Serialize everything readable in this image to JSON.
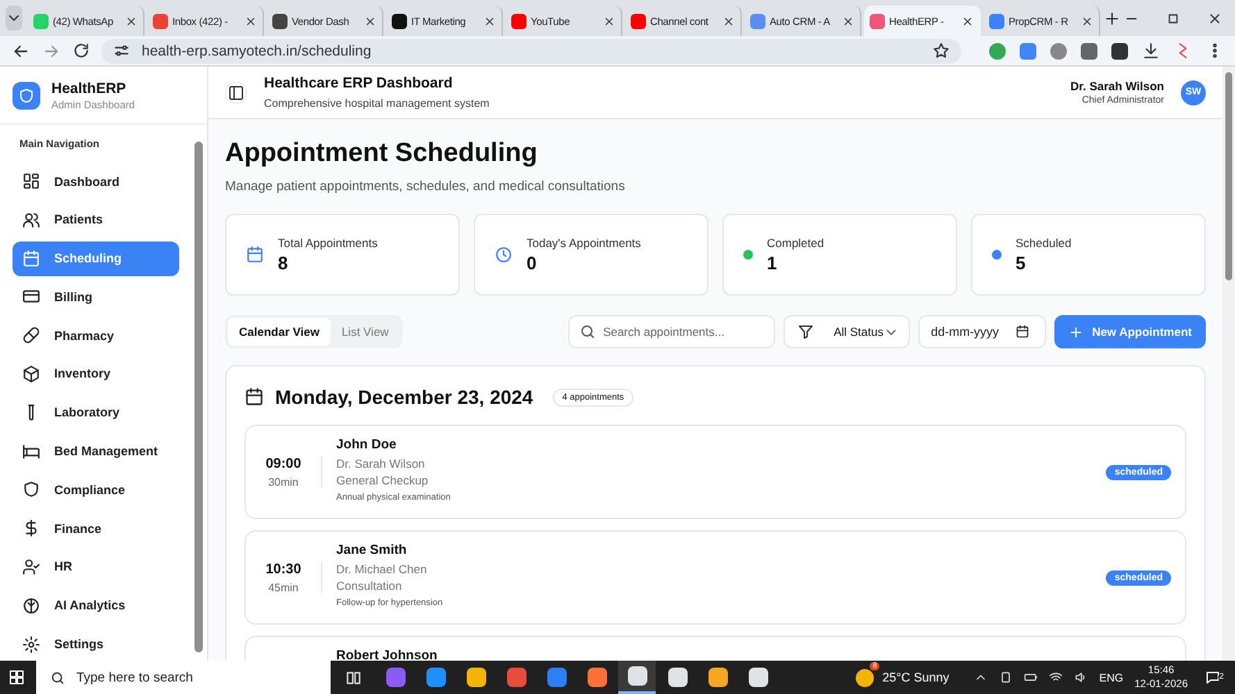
{
  "browser": {
    "tabs": [
      {
        "title": "(42) WhatsAp",
        "selected": false,
        "color": "#25d366"
      },
      {
        "title": "Inbox (422) -",
        "selected": false,
        "color": "#ea4335"
      },
      {
        "title": "Vendor Dash",
        "selected": false,
        "color": "#444444"
      },
      {
        "title": "IT Marketing",
        "selected": false,
        "color": "#111111"
      },
      {
        "title": "YouTube",
        "selected": false,
        "color": "#ff0000"
      },
      {
        "title": "Channel cont",
        "selected": false,
        "color": "#ff0000"
      },
      {
        "title": "Auto CRM - A",
        "selected": false,
        "color": "#5b8def"
      },
      {
        "title": "HealthERP - ",
        "selected": true,
        "color": "#f0567a"
      },
      {
        "title": "PropCRM - R",
        "selected": false,
        "color": "#3b82f6"
      }
    ],
    "url": "health-erp.samyotech.in/scheduling"
  },
  "sidebar": {
    "brand": "HealthERP",
    "tagline": "Admin Dashboard",
    "section": "Main Navigation",
    "items": [
      {
        "label": "Dashboard",
        "selected": false
      },
      {
        "label": "Patients",
        "selected": false
      },
      {
        "label": "Scheduling",
        "selected": true
      },
      {
        "label": "Billing",
        "selected": false
      },
      {
        "label": "Pharmacy",
        "selected": false
      },
      {
        "label": "Inventory",
        "selected": false
      },
      {
        "label": "Laboratory",
        "selected": false
      },
      {
        "label": "Bed Management",
        "selected": false
      },
      {
        "label": "Compliance",
        "selected": false
      },
      {
        "label": "Finance",
        "selected": false
      },
      {
        "label": "HR",
        "selected": false
      },
      {
        "label": "AI Analytics",
        "selected": false
      },
      {
        "label": "Settings",
        "selected": false
      }
    ]
  },
  "header": {
    "title": "Healthcare ERP Dashboard",
    "subtitle": "Comprehensive hospital management system",
    "user": "Dr. Sarah Wilson",
    "role": "Chief Administrator",
    "initials": "SW"
  },
  "page": {
    "title": "Appointment Scheduling",
    "subtitle": "Manage patient appointments, schedules, and medical consultations"
  },
  "stats": [
    {
      "label": "Total Appointments",
      "value": "8",
      "kind": "calendar"
    },
    {
      "label": "Today's Appointments",
      "value": "0",
      "kind": "clock"
    },
    {
      "label": "Completed",
      "value": "1",
      "kind": "dot",
      "color": "#22c55e"
    },
    {
      "label": "Scheduled",
      "value": "5",
      "kind": "dot",
      "color": "#3b82f6"
    }
  ],
  "view_tabs": [
    {
      "label": "Calendar View",
      "selected": true
    },
    {
      "label": "List View",
      "selected": false
    }
  ],
  "search": {
    "placeholder": "Search appointments..."
  },
  "status_filter": {
    "value": "All Status"
  },
  "date_filter": {
    "placeholder": "dd-mm-yyyy"
  },
  "new_button": {
    "label": "New Appointment"
  },
  "day": {
    "date": "Monday, December 23, 2024",
    "count": "4 appointments",
    "appointments": [
      {
        "time": "09:00",
        "duration": "30min",
        "patient": "John Doe",
        "doctor": "Dr. Sarah Wilson",
        "type": "General Checkup",
        "notes": "Annual physical examination",
        "status": "scheduled"
      },
      {
        "time": "10:30",
        "duration": "45min",
        "patient": "Jane Smith",
        "doctor": "Dr. Michael Chen",
        "type": "Consultation",
        "notes": "Follow-up for hypertension",
        "status": "scheduled"
      },
      {
        "patient": "Robert Johnson"
      }
    ]
  },
  "taskbar": {
    "search_placeholder": "Type here to search",
    "weather_badge": "8",
    "weather": "25°C Sunny",
    "language": "ENG",
    "time": "15:46",
    "date": "12-01-2026",
    "notifications": "2"
  }
}
